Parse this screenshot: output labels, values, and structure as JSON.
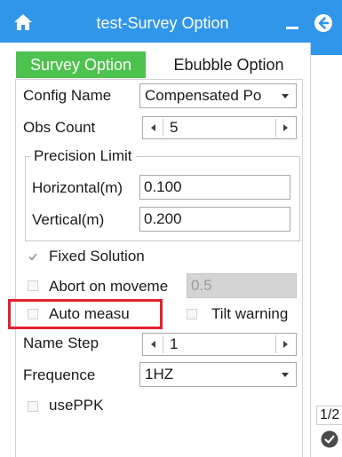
{
  "window": {
    "title": "test-Survey Option",
    "home_icon": "home-icon",
    "minimize_icon": "minimize-icon",
    "back_icon": "back-arrow-icon",
    "accent": "#2f96ea"
  },
  "tabs": [
    {
      "label": "Survey Option",
      "active": true,
      "color": "#4dc24e"
    },
    {
      "label": "Ebubble Option",
      "active": false
    }
  ],
  "form": {
    "config_name": {
      "label": "Config Name",
      "value": "Compensated Po"
    },
    "obs_count": {
      "label": "Obs Count",
      "value": "5"
    },
    "precision": {
      "title": "Precision Limit",
      "horizontal": {
        "label": "Horizontal(m)",
        "value": "0.100"
      },
      "vertical": {
        "label": "Vertical(m)",
        "value": "0.200"
      }
    },
    "fixed_solution": {
      "label": "Fixed Solution",
      "checked": true
    },
    "abort_on_movement": {
      "label": "Abort on moveme",
      "checked": false,
      "value": "0.5"
    },
    "auto_measure": {
      "label": "Auto measu",
      "checked": false
    },
    "tilt_warning": {
      "label": "Tilt warning",
      "checked": false
    },
    "name_step": {
      "label": "Name Step",
      "value": "1"
    },
    "frequence": {
      "label": "Frequence",
      "value": "1HZ"
    },
    "use_ppk": {
      "label": "usePPK",
      "checked": false
    }
  },
  "pager": {
    "text": "1/2"
  },
  "confirm_icon": "check-circle-icon",
  "highlight_color": "#e3202e"
}
